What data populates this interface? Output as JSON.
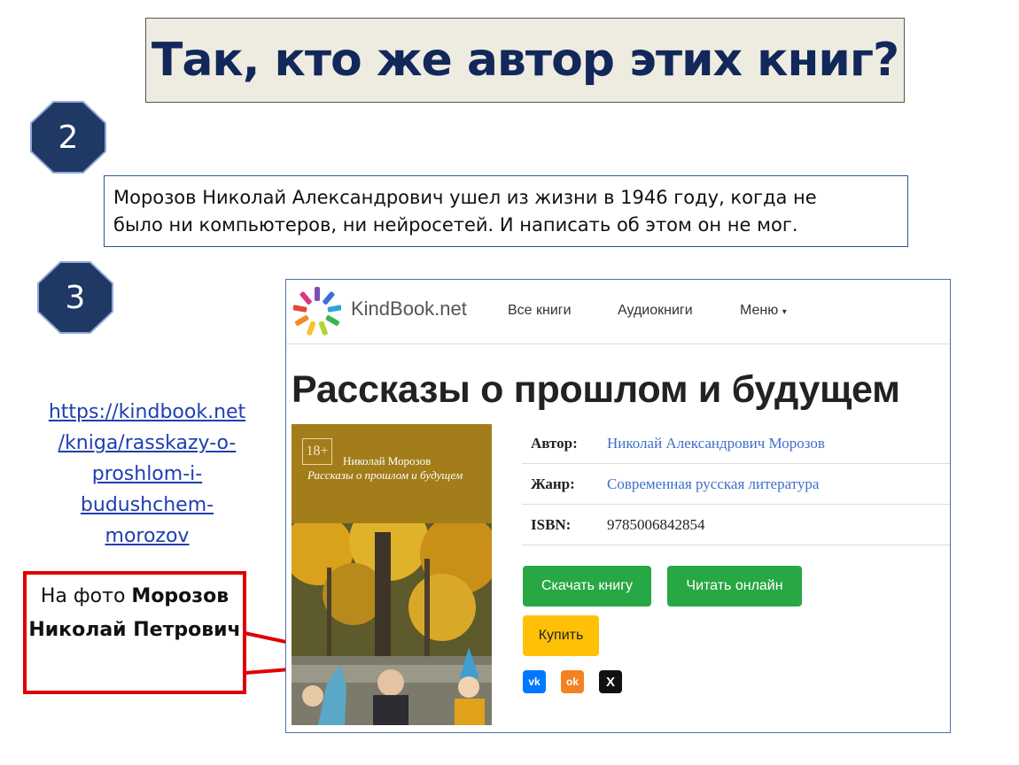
{
  "slide": {
    "title": "Так, кто же  автор этих книг?",
    "step2": "2",
    "step3": "3",
    "info_line1": "Морозов Николай Александрович ушел из жизни в 1946 году, когда  не",
    "info_line2": "было ни компьютеров, ни нейросетей. И написать об этом он не мог.",
    "link_lines": [
      "https://kindbook.net",
      "/kniga/rasskazy-o-",
      "proshlom-i-",
      "budushchem-",
      "morozov"
    ],
    "caption_prefix": "На фото ",
    "caption_bold": "Морозов Николай Петрович"
  },
  "site": {
    "brand": "KindBook.net",
    "nav": {
      "all_books": "Все книги",
      "audiobooks": "Аудиокниги",
      "menu": "Меню"
    },
    "book_title": "Рассказы о прошлом и будущем",
    "cover": {
      "age": "18+",
      "author": "Николай Морозов",
      "title": "Рассказы о прошлом и будущем"
    },
    "meta": {
      "author_label": "Автор:",
      "author_value": "Николай Александрович Морозов",
      "genre_label": "Жанр:",
      "genre_value": "Современная русская литература",
      "isbn_label": "ISBN:",
      "isbn_value": "9785006842854"
    },
    "buttons": {
      "download": "Скачать книгу",
      "read_online": "Читать онлайн",
      "buy": "Купить"
    },
    "social": {
      "vk": "vk",
      "ok": "ok",
      "x": "X"
    },
    "colors": {
      "primary_green": "#28a745",
      "buy_yellow": "#ffc107",
      "link_blue": "#3e6fc9",
      "title_navy": "#12285a",
      "highlight_red": "#e00000"
    }
  }
}
